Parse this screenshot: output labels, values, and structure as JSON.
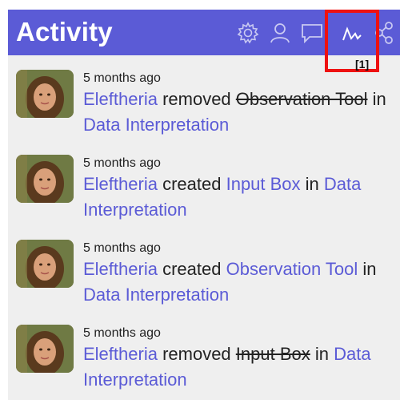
{
  "header": {
    "title": "Activity",
    "highlight_label": "[1]",
    "icons": [
      "gear-icon",
      "person-icon",
      "comment-icon",
      "activity-icon",
      "share-icon"
    ]
  },
  "activities": [
    {
      "time": "5 months ago",
      "user": "Eleftheria",
      "action": "removed",
      "object": "Observation Tool",
      "object_removed": true,
      "preposition": "in",
      "location": "Data Interpretation"
    },
    {
      "time": "5 months ago",
      "user": "Eleftheria",
      "action": "created",
      "object": "Input Box",
      "object_removed": false,
      "preposition": "in",
      "location": "Data Interpretation"
    },
    {
      "time": "5 months ago",
      "user": "Eleftheria",
      "action": "created",
      "object": "Observation Tool",
      "object_removed": false,
      "preposition": "in",
      "location": "Data Interpretation"
    },
    {
      "time": "5 months ago",
      "user": "Eleftheria",
      "action": "removed",
      "object": "Input Box",
      "object_removed": true,
      "preposition": "in",
      "location": "Data Interpretation"
    }
  ],
  "colors": {
    "header_bg": "#5b5bd6",
    "link": "#5b5bd6",
    "panel_bg": "#efefef",
    "highlight": "#ee1111"
  }
}
